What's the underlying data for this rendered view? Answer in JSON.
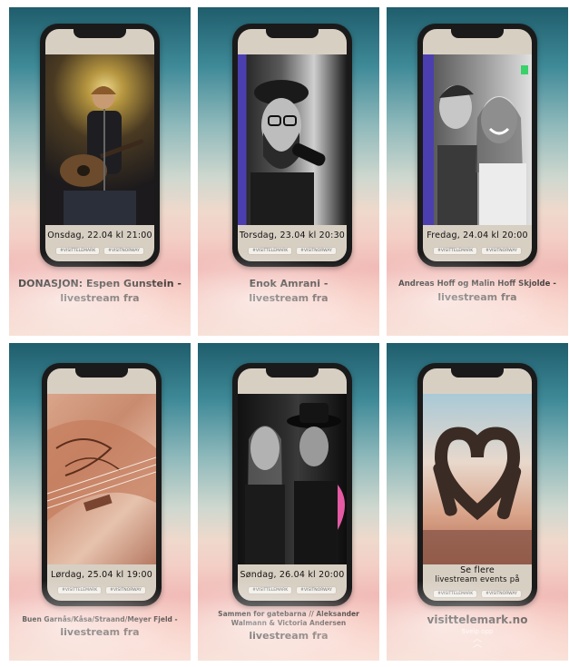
{
  "panels": [
    {
      "date": "Onsdag, 22.04 kl 21:00",
      "tags": [
        "#VISITTELEMARK",
        "#VISITNORWAY"
      ],
      "caption_lines": [
        "DONASJON: Espen Gunstein -",
        "livestream fra"
      ]
    },
    {
      "date": "Torsdag, 23.04 kl 20:30",
      "tags": [
        "#VISITTELEMARK",
        "#VISITNORWAY"
      ],
      "caption_lines": [
        "Enok Amrani -",
        "livestream fra"
      ]
    },
    {
      "date": "Fredag, 24.04 kl 20:00",
      "tags": [
        "#VISITTELEMARK",
        "#VISITNORWAY"
      ],
      "caption_lines": [
        "Andreas Hoff og Malin Hoff Skjolde -",
        "livestream fra"
      ]
    },
    {
      "date": "Lørdag, 25.04 kl 19:00",
      "tags": [
        "#VISITTELEMARK",
        "#VISITNORWAY"
      ],
      "caption_lines": [
        "Buen Garnås/Kåsa/Straand/Meyer Fjeld -",
        "livestream fra"
      ]
    },
    {
      "date": "Søndag, 26.04 kl 20:00",
      "tags": [
        "#VISITTELEMARK",
        "#VISITNORWAY"
      ],
      "caption_lines": [
        "Sammen for gatebarna // Aleksander",
        "Walmann & Victoria Andersen",
        "livestream fra"
      ]
    },
    {
      "date_lines": [
        "Se flere",
        "livestream events på"
      ],
      "tags": [
        "#VISITTELEMARK",
        "#VISITNORWAY"
      ],
      "caption_lines": [
        "visittelemark.no"
      ],
      "swipe": "Sveip opp"
    }
  ]
}
